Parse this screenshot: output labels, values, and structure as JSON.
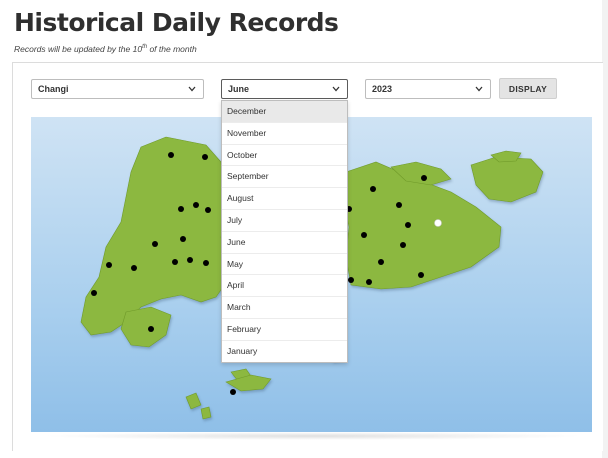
{
  "header": {
    "title": "Historical Daily Records",
    "subtitle_before": "Records will be updated by the 10",
    "subtitle_sup": "th",
    "subtitle_after": " of the month"
  },
  "filters": {
    "station": "Changi",
    "month": "June",
    "year": "2023",
    "display_label": "DISPLAY"
  },
  "month_dropdown": {
    "selected": "December",
    "options": [
      "December",
      "November",
      "October",
      "September",
      "August",
      "July",
      "June",
      "May",
      "April",
      "March",
      "February",
      "January"
    ]
  },
  "map": {
    "land_color": "#8cb83f",
    "water_color": "#a9cfee",
    "station_marker_color": "#000000",
    "highlight_marker_color": "#ffffff"
  }
}
